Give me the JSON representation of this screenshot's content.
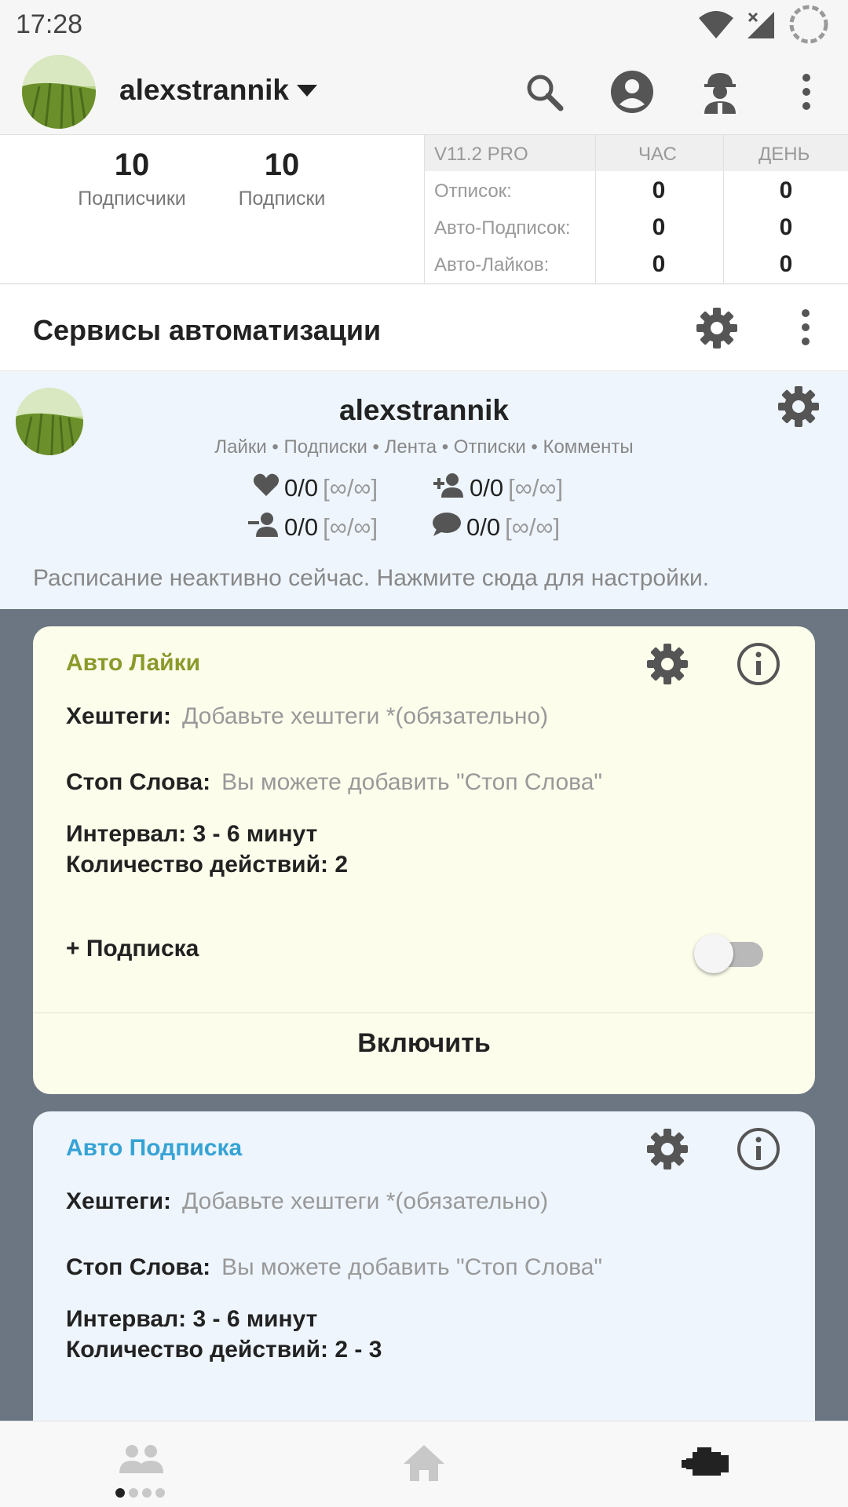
{
  "status_bar": {
    "time": "17:28",
    "icons": [
      "wifi-icon",
      "signal-off-icon",
      "loading-icon"
    ]
  },
  "app_bar": {
    "username": "alexstrannik",
    "actions": [
      "search-icon",
      "account-icon",
      "worker-icon",
      "more-vert-icon"
    ]
  },
  "profile_stats": {
    "followers": {
      "value": "10",
      "label": "Подписчики"
    },
    "following": {
      "value": "10",
      "label": "Подписки"
    }
  },
  "stats_table": {
    "headers": [
      "V11.2 PRO",
      "ЧАС",
      "ДЕНЬ"
    ],
    "rows": [
      {
        "label": "Отписок:",
        "hour": "0",
        "day": "0"
      },
      {
        "label": "Авто-Подписок:",
        "hour": "0",
        "day": "0"
      },
      {
        "label": "Авто-Лайков:",
        "hour": "0",
        "day": "0"
      }
    ]
  },
  "section": {
    "title": "Сервисы автоматизации"
  },
  "account": {
    "name": "alexstrannik",
    "services": "Лайки • Подписки • Лента • Отписки • Комменты",
    "metrics": {
      "likes": {
        "value": "0/0",
        "limit": "[∞/∞]"
      },
      "follows": {
        "value": "0/0",
        "limit": "[∞/∞]"
      },
      "unfollows": {
        "value": "0/0",
        "limit": "[∞/∞]"
      },
      "comments": {
        "value": "0/0",
        "limit": "[∞/∞]"
      }
    },
    "schedule": "Расписание неактивно сейчас. Нажмите сюда для настройки."
  },
  "cards": [
    {
      "title": "Авто Лайки",
      "title_color": "#8c9a2c",
      "hashtags_label": "Хештеги:",
      "hashtags_placeholder": "Добавьте хештеги *(обязательно)",
      "stopwords_label": "Стоп Слова:",
      "stopwords_placeholder": "Вы можете добавить \"Стоп Слова\"",
      "interval": "Интервал: 3 - 6 минут",
      "actions_count": "Количество действий: 2",
      "follow_toggle_label": "+ Подписка",
      "follow_toggle_on": false,
      "enable_label": "Включить"
    },
    {
      "title": "Авто Подписка",
      "title_color": "#36a3d4",
      "hashtags_label": "Хештеги:",
      "hashtags_placeholder": "Добавьте хештеги *(обязательно)",
      "stopwords_label": "Стоп Слова:",
      "stopwords_placeholder": "Вы можете добавить \"Стоп Слова\"",
      "interval": "Интервал: 3 - 6 минут",
      "actions_count": "Количество действий: 2 - 3"
    }
  ],
  "bottom_nav": {
    "items": [
      "accounts-icon",
      "home-icon",
      "engine-icon"
    ],
    "active": "engine-icon"
  }
}
